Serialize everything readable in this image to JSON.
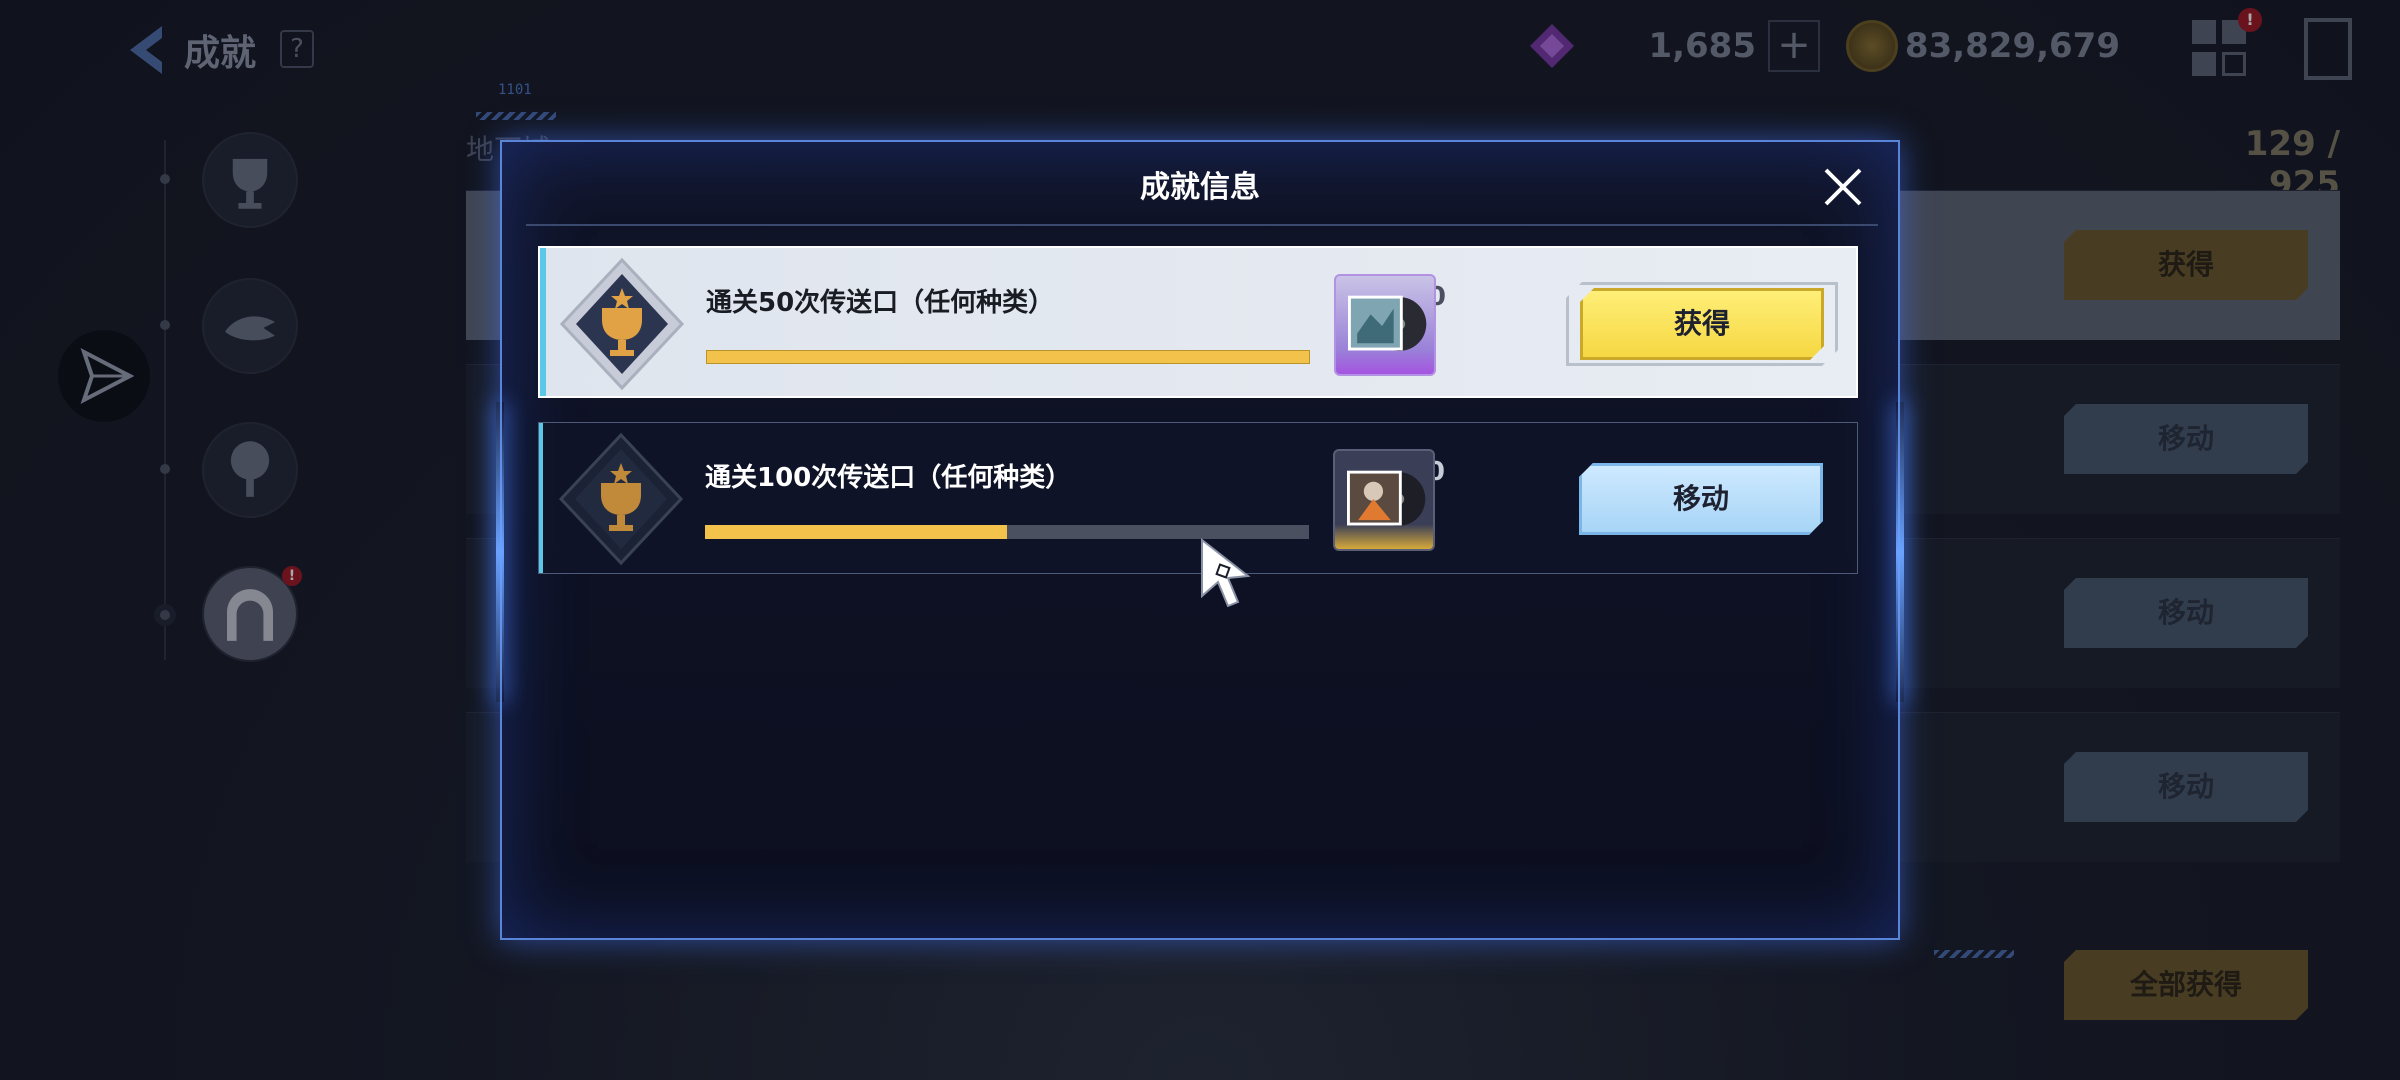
{
  "header": {
    "title": "成就",
    "help_label": "?",
    "gem_value": "1,685",
    "plus_label": "+",
    "coin_value": "83,829,679",
    "notification_badge": "!"
  },
  "sidebar": {
    "items": [
      {
        "icon": "trophy-icon"
      },
      {
        "icon": "fish-icon"
      },
      {
        "icon": "tree-icon"
      },
      {
        "icon": "gate-icon",
        "badge": "!"
      }
    ],
    "active_icon": "paper-plane-icon"
  },
  "background_list": {
    "section_label": "地下城",
    "count": "129 / 925",
    "buttons": [
      "获得",
      "移动",
      "移动",
      "移动"
    ],
    "claim_all_label": "全部获得"
  },
  "modal": {
    "title": "成就信息",
    "close_icon": "close-icon",
    "achievements": [
      {
        "name": "通关50次传送口（任何种类）",
        "progress_text": "50/50",
        "current": 50,
        "total": 50,
        "reward_rarity": "purple",
        "action_label": "获得"
      },
      {
        "name": "通关100次传送口（任何种类）",
        "progress_text": "50/100",
        "current": 50,
        "total": 100,
        "reward_rarity": "gold",
        "action_label": "移动"
      }
    ]
  },
  "decor": {
    "code": "1101"
  },
  "colors": {
    "accent_blue": "#5a84d8",
    "claim_yellow": "#f5d640",
    "move_blue": "#a6d4f6",
    "progress_fill": "#f2c24a"
  }
}
